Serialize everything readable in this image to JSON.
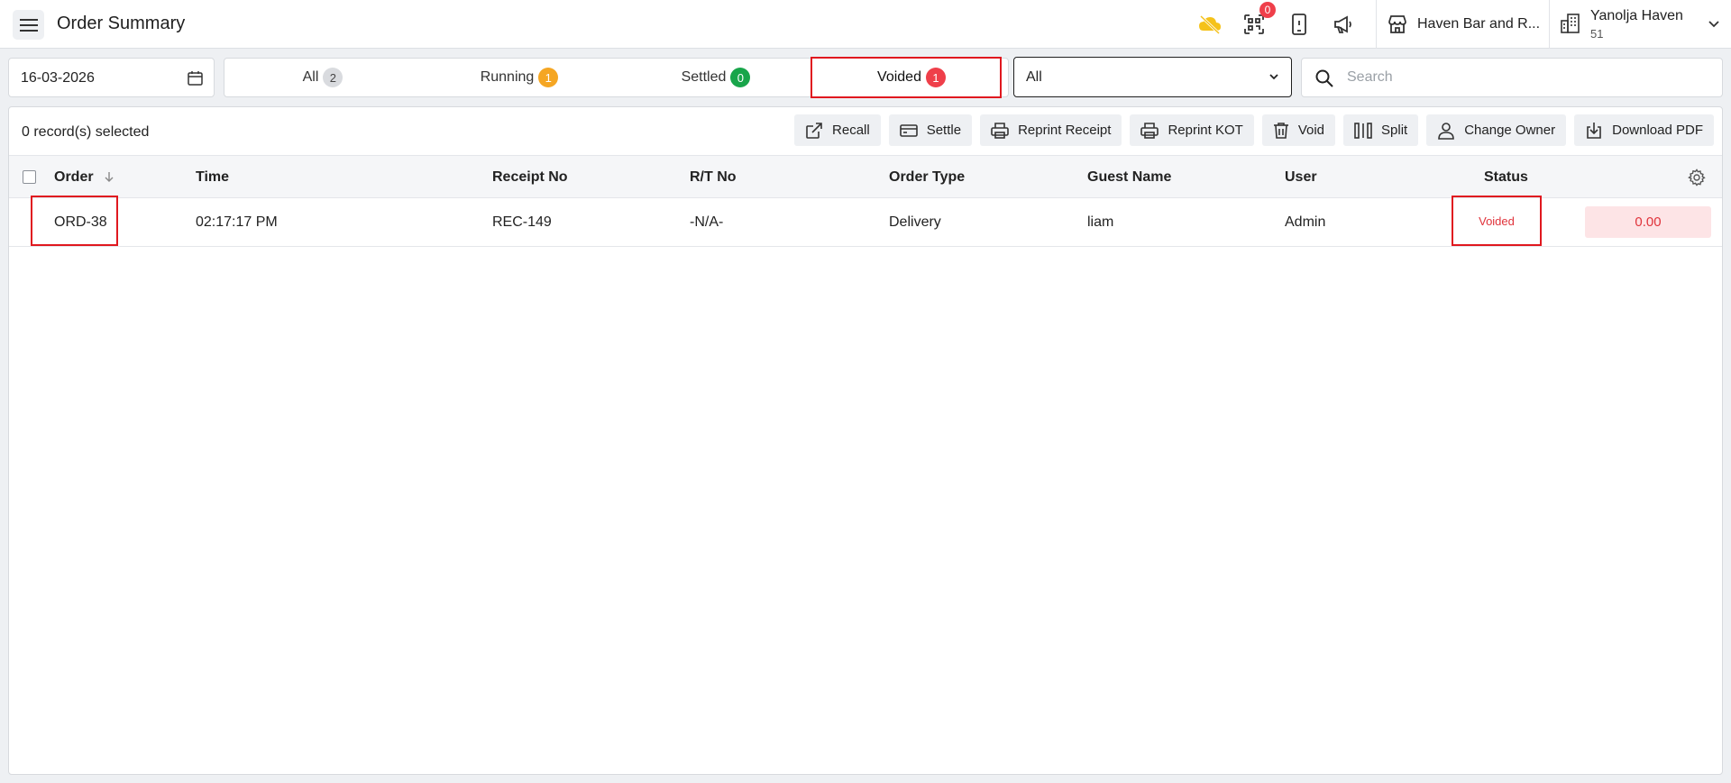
{
  "header": {
    "title": "Order Summary",
    "qr_badge": "0",
    "store_name": "Haven Bar and R...",
    "profile_name": "Yanolja Haven",
    "profile_sub": "51"
  },
  "filters": {
    "date": "16-03-2026",
    "tabs": [
      {
        "label": "All",
        "count": "2",
        "color": "#d9dbdf",
        "text_color": "#444444"
      },
      {
        "label": "Running",
        "count": "1",
        "color": "#f5a623",
        "text_color": "#ffffff"
      },
      {
        "label": "Settled",
        "count": "0",
        "color": "#18a54a",
        "text_color": "#ffffff"
      },
      {
        "label": "Voided",
        "count": "1",
        "color": "#ef3f4a",
        "text_color": "#ffffff"
      }
    ],
    "active_tab": "Voided",
    "order_type_select": "All",
    "search_placeholder": "Search"
  },
  "toolbar": {
    "selected_text": "0 record(s) selected",
    "actions": [
      "Recall",
      "Settle",
      "Reprint Receipt",
      "Reprint KOT",
      "Void",
      "Split",
      "Change Owner",
      "Download PDF"
    ]
  },
  "table": {
    "columns": [
      "Order",
      "Time",
      "Receipt No",
      "R/T No",
      "Order Type",
      "Guest Name",
      "User",
      "Status"
    ],
    "rows": [
      {
        "order": "ORD-38",
        "time": "02:17:17 PM",
        "receipt_no": "REC-149",
        "rt_no": "-N/A-",
        "order_type": "Delivery",
        "guest_name": "liam",
        "user": "Admin",
        "status": "Voided",
        "amount": "0.00"
      }
    ]
  },
  "colors": {
    "accent_red": "#e0181f",
    "voided_text": "#e0333b",
    "voided_bg": "#fde4e6"
  }
}
